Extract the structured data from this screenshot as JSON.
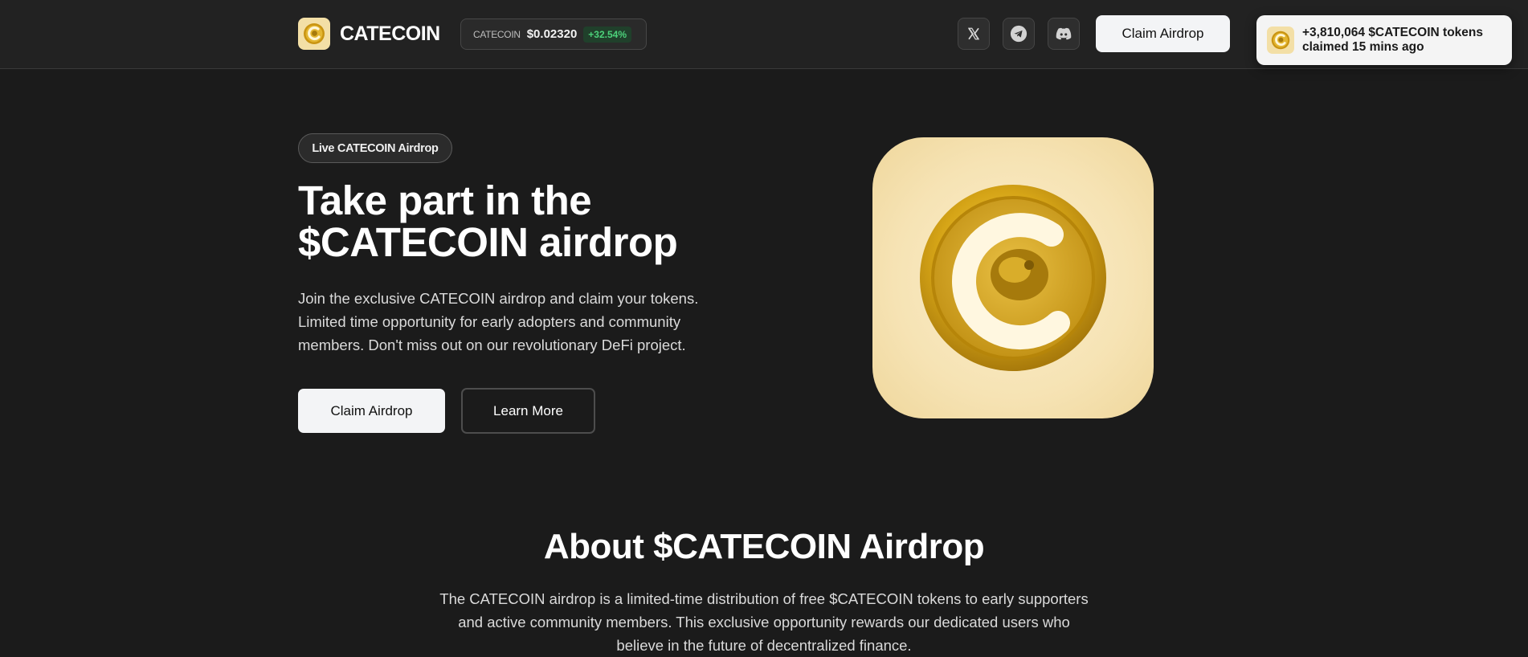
{
  "brand": {
    "name": "CATECOIN",
    "logo_icon": "catecoin-logo-icon"
  },
  "ticker": {
    "symbol": "CATECOIN",
    "price": "$0.02320",
    "change": "+32.54%",
    "change_color": "#4cd17a"
  },
  "social": {
    "x_icon": "x-twitter-icon",
    "telegram_icon": "telegram-icon",
    "discord_icon": "discord-icon"
  },
  "header": {
    "claim_label": "Claim Airdrop"
  },
  "toast": {
    "line1": "+3,810,064 $CATECOIN tokens",
    "line2": "claimed 15 mins ago"
  },
  "hero": {
    "badge": "Live CATECOIN Airdrop",
    "title_line1": " Take part in the",
    "title_line2": "$CATECOIN airdrop",
    "desc_line1": "Join the exclusive CATECOIN airdrop and claim your tokens.",
    "desc_line2": "Limited time opportunity for early adopters and community",
    "desc_line3": "members. Don't miss out on our revolutionary DeFi project.",
    "primary_label": "Claim Airdrop",
    "secondary_label": "Learn More"
  },
  "about": {
    "title": "About $CATECOIN Airdrop",
    "desc_line1": "The CATECOIN airdrop is a limited-time distribution of free $CATECOIN tokens to early supporters",
    "desc_line2": "and active community members. This exclusive opportunity rewards our dedicated users who",
    "desc_line3": "believe in the future of decentralized finance."
  },
  "colors": {
    "background": "#1b1b1b",
    "header": "#222222",
    "coin_gold": "#d4a017",
    "button_light": "#f3f4f6"
  }
}
